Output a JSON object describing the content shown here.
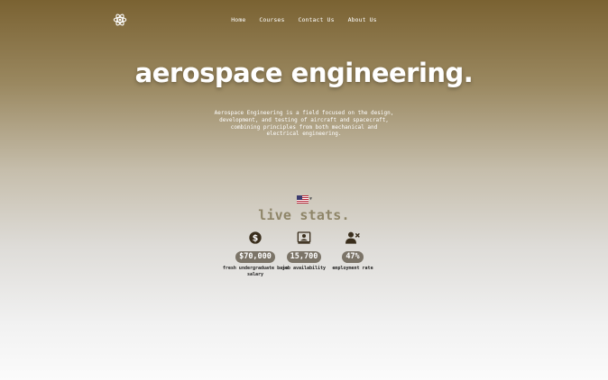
{
  "nav": {
    "logo_icon": "atom-icon",
    "links": [
      "Home",
      "Courses",
      "Contact Us",
      "About Us"
    ]
  },
  "hero": {
    "title": "aerospace engineering.",
    "description": "Aerospace Engineering is a field focused on the design, development, and testing of aircraft and spacecraft, combining principles from both mechanical and electrical engineering."
  },
  "language": {
    "icon": "us-flag-icon"
  },
  "stats": {
    "title": "live stats.",
    "items": [
      {
        "icon": "dollar-circle-icon",
        "value": "$70,000",
        "label": "fresh undergraduate base salary"
      },
      {
        "icon": "job-board-icon",
        "value": "15,700",
        "label": "job availability"
      },
      {
        "icon": "user-remove-icon",
        "value": "47%",
        "label": "employment rate"
      }
    ]
  },
  "colors": {
    "gradient_top": "#7a6232",
    "gradient_bottom": "#fbfbfb",
    "stats_title": "#8e8568",
    "badge_bg": "#7b7468",
    "icon_dark": "#3a2e1c"
  }
}
